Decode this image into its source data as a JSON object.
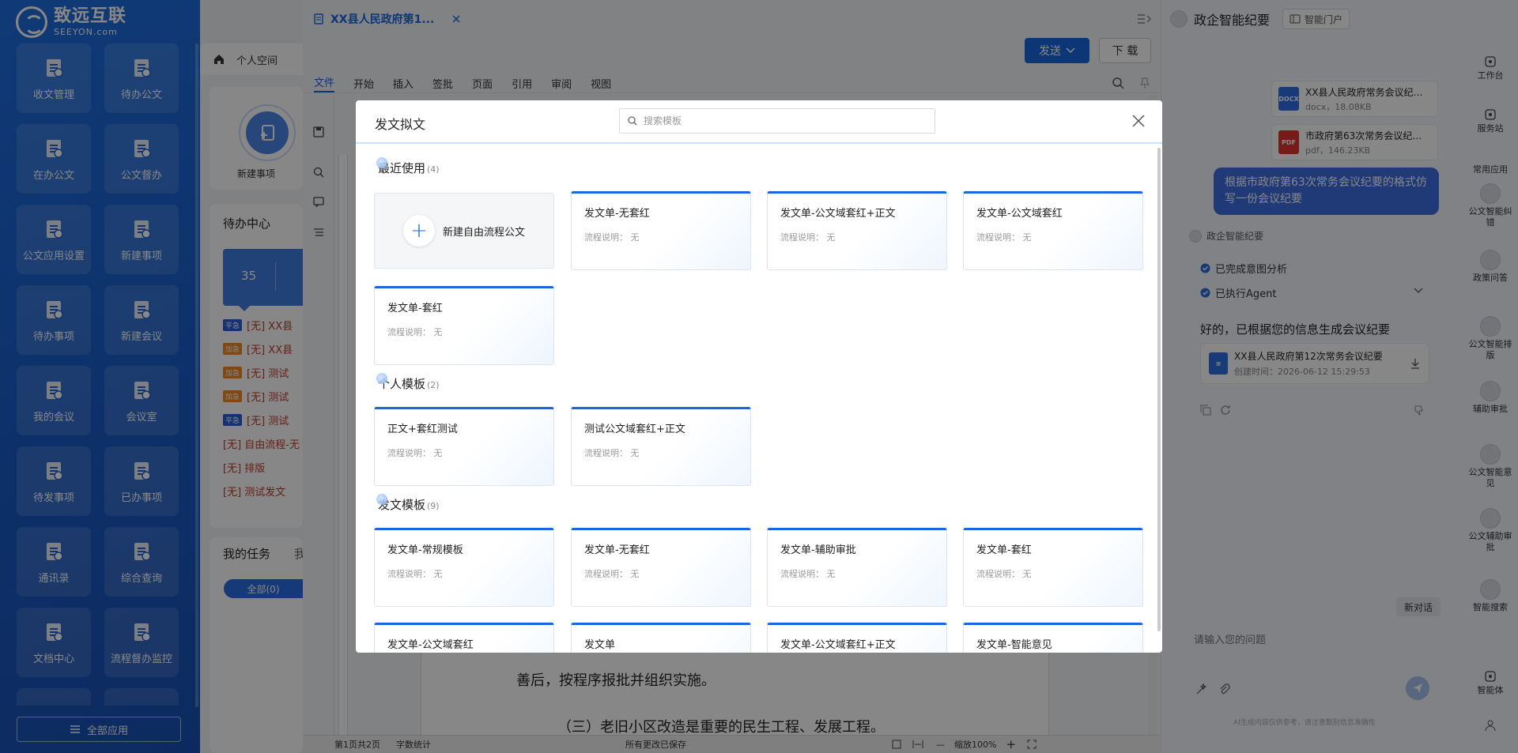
{
  "brand": {
    "name_cn": "致远互联",
    "name_en": "SEEYON.com"
  },
  "sidebar": {
    "tiles": [
      {
        "label": "收文管理",
        "icon": "inbox-doc-icon"
      },
      {
        "label": "待办公文",
        "icon": "pending-doc-icon"
      },
      {
        "label": "在办公文",
        "icon": "processing-doc-icon"
      },
      {
        "label": "公文督办",
        "icon": "supervise-icon"
      },
      {
        "label": "公文应用设置",
        "icon": "settings-icon"
      },
      {
        "label": "新建事项",
        "icon": "new-item-icon"
      },
      {
        "label": "待办事项",
        "icon": "todo-icon"
      },
      {
        "label": "新建会议",
        "icon": "new-meeting-icon"
      },
      {
        "label": "我的会议",
        "icon": "my-meeting-icon"
      },
      {
        "label": "会议室",
        "icon": "meeting-room-icon"
      },
      {
        "label": "待发事项",
        "icon": "to-send-icon"
      },
      {
        "label": "已办事项",
        "icon": "done-icon"
      },
      {
        "label": "通讯录",
        "icon": "contacts-icon"
      },
      {
        "label": "综合查询",
        "icon": "search-icon"
      },
      {
        "label": "文档中心",
        "icon": "document-center-icon"
      },
      {
        "label": "流程督办监控",
        "icon": "process-monitor-icon"
      }
    ],
    "all_apps": "全部应用"
  },
  "personal": {
    "title": "个人空间",
    "new_item": "新建事项",
    "pending_center": "待办中心",
    "pending_count": "35",
    "pending_list": [
      {
        "tag": "平急",
        "tag_color": "#2b5fd9",
        "text": "[无] XX县"
      },
      {
        "tag": "加急",
        "tag_color": "#f08a24",
        "text": "[无] XX县"
      },
      {
        "tag": "加急",
        "tag_color": "#f08a24",
        "text": "[无] 测试"
      },
      {
        "tag": "加急",
        "tag_color": "#f08a24",
        "text": "[无] 测试"
      },
      {
        "tag": "平急",
        "tag_color": "#2b5fd9",
        "text": "[无] 测试"
      },
      {
        "tag": "",
        "tag_color": "",
        "text": "[无] 自由流程-无"
      },
      {
        "tag": "",
        "tag_color": "",
        "text": "[无] 排版"
      },
      {
        "tag": "",
        "tag_color": "",
        "text": "[无] 测试发文"
      }
    ],
    "my_tasks": "我的任务",
    "my_tasks_tab": "我",
    "all_pill": "全部(0)"
  },
  "document": {
    "tab_title": "XX县人民政府第1...",
    "send_button": "发送",
    "download_button": "下 载",
    "menu": [
      "文件",
      "开始",
      "插入",
      "签批",
      "页面",
      "引用",
      "审阅",
      "视图"
    ],
    "body_lines": [
      "善后，按程序报批并组织实施。",
      "（三）老旧小区改造是重要的民生工程、发展工程。"
    ],
    "status": {
      "page": "第1页共2页",
      "word_count": "字数统计",
      "saved": "所有更改已保存",
      "zoom": "缩放100%"
    }
  },
  "ai": {
    "title": "政企智能纪要",
    "portal_button": "智能门户",
    "files": [
      {
        "type": "DOCX",
        "color": "#2f6fe4",
        "name": "XX县人民政府常务会议纪…",
        "meta": "docx，18.08KB"
      },
      {
        "type": "PDF",
        "color": "#e0342f",
        "name": "市政府第63次常务会议纪…",
        "meta": "pdf，146.23KB"
      }
    ],
    "user_message": "根据市政府第63次常务会议纪要的格式仿写一份会议纪要",
    "bot_name": "政企智能纪要",
    "steps": [
      "已完成意图分析",
      "已执行Agent"
    ],
    "reply": "好的，已根据您的信息生成会议纪要",
    "result_file": {
      "name": "XX县人民政府第12次常务会议纪要",
      "meta": "创建时间：2026-06-12 15:29:53"
    },
    "new_chat": "新对话",
    "input_placeholder": "请输入您的问题",
    "disclaimer": "AI生成内容仅供参考，请注意甄别信息准确性"
  },
  "rail": [
    {
      "label": "工作台",
      "kind": "icon",
      "icon": "workbench-icon"
    },
    {
      "label": "服务站",
      "kind": "icon",
      "icon": "service-icon"
    },
    {
      "label": "常用应用",
      "kind": "heading",
      "icon": ""
    },
    {
      "label": "公文智能纠错",
      "kind": "avatar",
      "icon": "assistant-avatar-icon"
    },
    {
      "label": "政策问答",
      "kind": "avatar",
      "icon": "assistant-avatar-icon"
    },
    {
      "label": "公文智能排版",
      "kind": "avatar",
      "icon": "assistant-avatar-icon"
    },
    {
      "label": "辅助审批",
      "kind": "avatar",
      "icon": "assistant-avatar-icon"
    },
    {
      "label": "公文智能意见",
      "kind": "avatar",
      "icon": "assistant-avatar-icon"
    },
    {
      "label": "公文辅助审批",
      "kind": "avatar",
      "icon": "assistant-avatar-icon"
    },
    {
      "label": "智能搜索",
      "kind": "avatar",
      "icon": "assistant-avatar-icon"
    },
    {
      "label": "智能体",
      "kind": "icon",
      "icon": "agent-icon"
    }
  ],
  "modal": {
    "title": "发文拟文",
    "search_placeholder": "搜索模板",
    "new_free_flow": "新建自由流程公文",
    "desc_prefix": "流程说明：",
    "desc_none": "无",
    "sections": [
      {
        "title": "最近使用",
        "count": "(4)",
        "templates": [
          "发文单-无套红",
          "发文单-公文域套红+正文",
          "发文单-公文域套红",
          "发文单-套红"
        ]
      },
      {
        "title": "个人模板",
        "count": "(2)",
        "templates": [
          "正文+套红测试",
          "测试公文域套红+正文"
        ]
      },
      {
        "title": "发文模板",
        "count": "(9)",
        "templates": [
          "发文单-常规模板",
          "发文单-无套红",
          "发文单-辅助审批",
          "发文单-套红",
          "发文单-公文域套红",
          "发文单",
          "发文单-公文域套红+正文",
          "发文单-智能意见"
        ]
      }
    ]
  }
}
